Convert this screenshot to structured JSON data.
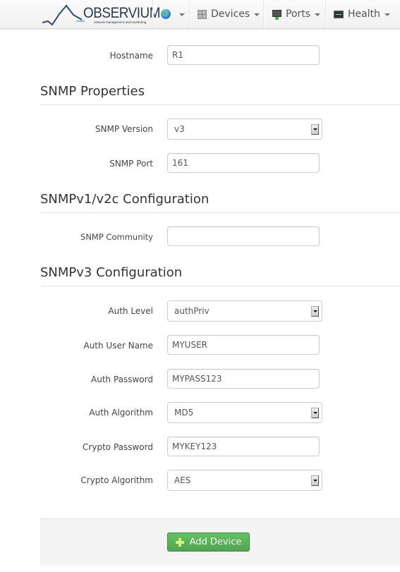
{
  "navbar": {
    "logo": {
      "title": "OBSERVIUM",
      "subtitle": "network management and monitoring"
    },
    "items": [
      {
        "label": "",
        "icon": "globe-icon"
      },
      {
        "label": "Devices",
        "icon": "devices-icon"
      },
      {
        "label": "Ports",
        "icon": "ports-icon"
      },
      {
        "label": "Health",
        "icon": "health-icon"
      }
    ]
  },
  "form": {
    "hostname": {
      "label": "Hostname",
      "value": "R1"
    },
    "sections": {
      "snmp_properties": "SNMP Properties",
      "snmp_v1v2c": "SNMPv1/v2c Configuration",
      "snmp_v3": "SNMPv3 Configuration"
    },
    "snmp_version": {
      "label": "SNMP Version",
      "value": "v3"
    },
    "snmp_port": {
      "label": "SNMP Port",
      "value": "161"
    },
    "snmp_community": {
      "label": "SNMP Community",
      "value": ""
    },
    "auth_level": {
      "label": "Auth Level",
      "value": "authPriv"
    },
    "auth_user_name": {
      "label": "Auth User Name",
      "value": "MYUSER"
    },
    "auth_password": {
      "label": "Auth Password",
      "value": "MYPASS123"
    },
    "auth_algorithm": {
      "label": "Auth Algorithm",
      "value": "MD5"
    },
    "crypto_password": {
      "label": "Crypto Password",
      "value": "MYKEY123"
    },
    "crypto_algorithm": {
      "label": "Crypto Algorithm",
      "value": "AES"
    },
    "submit_label": "Add Device"
  },
  "colors": {
    "success": "#5bb75b",
    "heading": "#333333"
  }
}
